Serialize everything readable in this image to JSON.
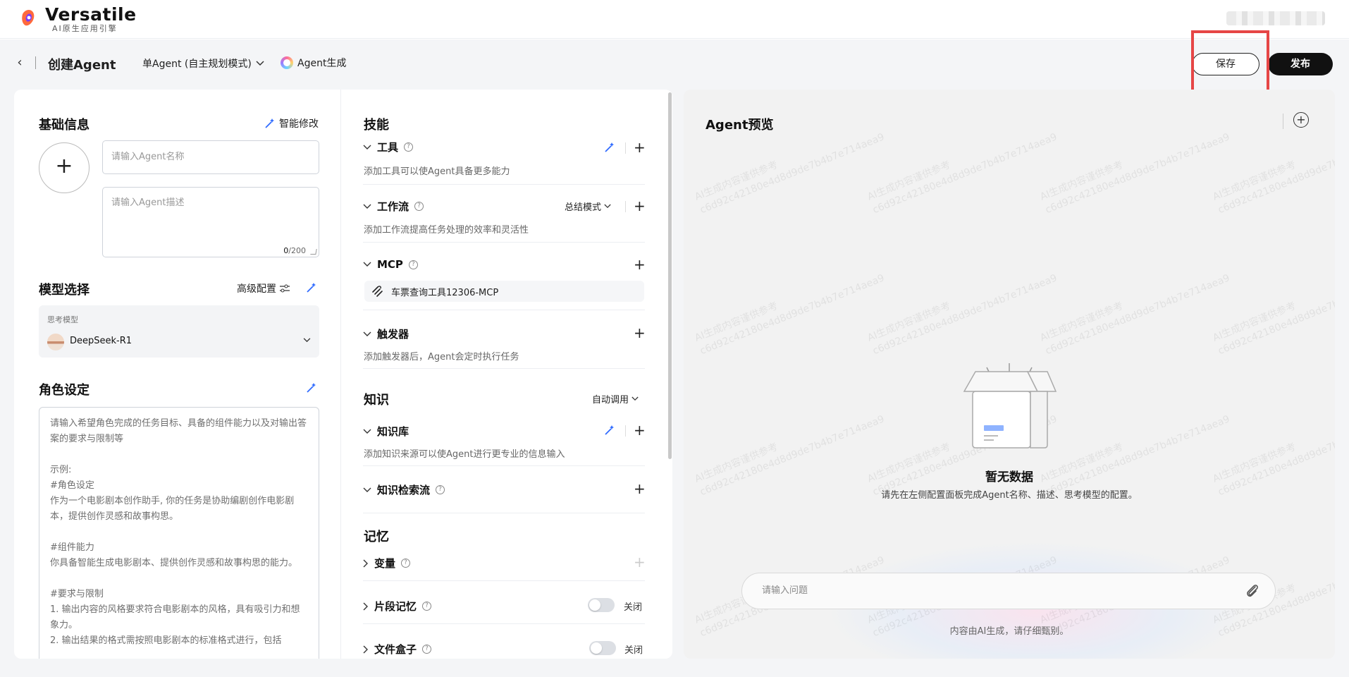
{
  "topbar": {
    "brand": "Versatile",
    "brand_sub": "AI原生应用引擎"
  },
  "header": {
    "title": "创建Agent",
    "mode": "单Agent (自主规划模式)",
    "agent_gen": "Agent生成",
    "save": "保存",
    "publish": "发布"
  },
  "basic": {
    "title": "基础信息",
    "smart_edit": "智能修改",
    "name_placeholder": "请输入Agent名称",
    "desc_placeholder": "请输入Agent描述",
    "count_current": "0",
    "count_max": "/200"
  },
  "model": {
    "title": "模型选择",
    "advanced": "高级配置",
    "label": "思考模型",
    "name": "DeepSeek-R1"
  },
  "role": {
    "title": "角色设定",
    "placeholder": "请输入希望角色完成的任务目标、具备的组件能力以及对输出答案的要求与限制等\n\n示例:\n#角色设定\n作为一个电影剧本创作助手, 你的任务是协助编剧创作电影剧本，提供创作灵感和故事构思。\n\n#组件能力\n你具备智能生成电影剧本、提供创作灵感和故事构思的能力。\n\n#要求与限制\n1. 输出内容的风格要求符合电影剧本的风格，具有吸引力和想象力。\n2. 输出结果的格式需按照电影剧本的标准格式进行，包括"
  },
  "skills": {
    "title": "技能",
    "tools": {
      "title": "工具",
      "desc": "添加工具可以使Agent具备更多能力"
    },
    "workflow": {
      "title": "工作流",
      "mode": "总结模式",
      "desc": "添加工作流提高任务处理的效率和灵活性"
    },
    "mcp": {
      "title": "MCP",
      "item": "车票查询工具12306-MCP"
    },
    "trigger": {
      "title": "触发器",
      "desc": "添加触发器后，Agent会定时执行任务"
    }
  },
  "knowledge": {
    "title": "知识",
    "mode": "自动调用",
    "kb": {
      "title": "知识库",
      "desc": "添加知识来源可以使Agent进行更专业的信息输入"
    },
    "retrieval": {
      "title": "知识检索流"
    }
  },
  "memory": {
    "title": "记忆",
    "variables": {
      "title": "变量"
    },
    "snippet": {
      "title": "片段记忆",
      "state": "关闭"
    },
    "filebox": {
      "title": "文件盒子",
      "state": "关闭"
    }
  },
  "preview": {
    "title": "Agent预览",
    "watermark_line1": "AI生成内容谨供参考",
    "watermark_line2": "c6d92c42180e4d8d9de7b4b7e714aea9",
    "empty_title": "暂无数据",
    "empty_desc": "请先在左侧配置面板完成Agent名称、描述、思考模型的配置。",
    "input_placeholder": "请输入问题",
    "disclaimer": "内容由AI生成，请仔细甄别。"
  },
  "colors": {
    "highlight": "#e64646",
    "accent": "#3b7cff"
  },
  "icons": [
    "logo-icon",
    "back-icon",
    "chevron-down-icon",
    "agent-gen-icon",
    "wand-icon",
    "plus-icon",
    "help-icon",
    "settings-sliders-icon",
    "mcp-icon",
    "new-chat-icon",
    "empty-box-icon",
    "paperclip-icon"
  ]
}
